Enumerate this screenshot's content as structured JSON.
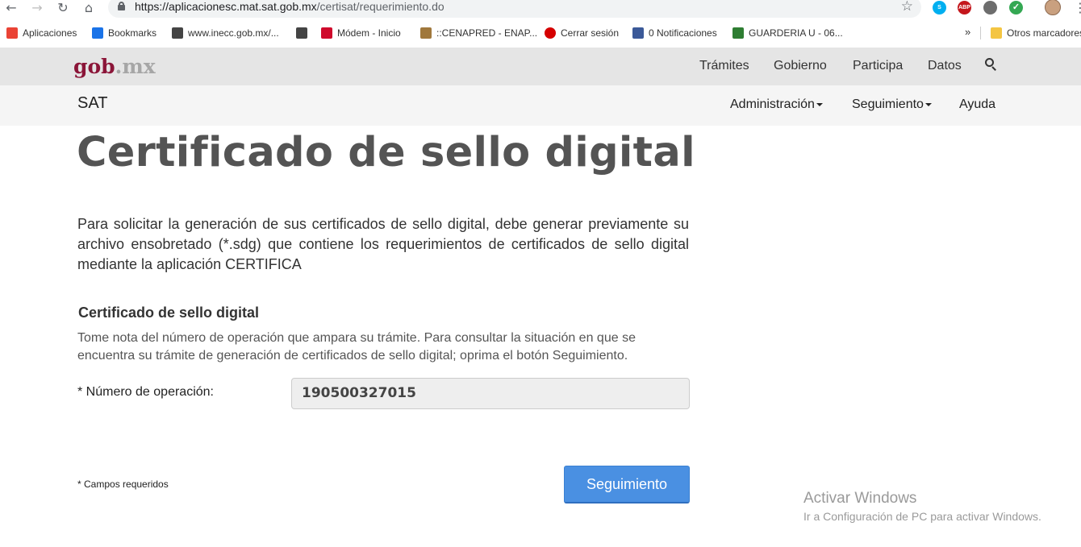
{
  "browser": {
    "url_host": "https://aplicacionesc.mat.sat.gob.mx",
    "url_path": "/certisat/requerimiento.do",
    "bookmarks": [
      {
        "label": "Aplicaciones",
        "icon": "apps-grid-icon",
        "color": "#ea4335"
      },
      {
        "label": "Bookmarks",
        "icon": "star-icon",
        "color": "#1a73e8"
      },
      {
        "label": "www.inecc.gob.mx/...",
        "icon": "globe-icon",
        "color": "#444444"
      },
      {
        "label": "",
        "icon": "globe-icon",
        "color": "#444444"
      },
      {
        "label": "Módem - Inicio",
        "icon": "huawei-icon",
        "color": "#cf0a2c"
      },
      {
        "label": "::CENAPRED - ENAP...",
        "icon": "cenapred-icon",
        "color": "#a0783c"
      },
      {
        "label": "Cerrar sesión",
        "icon": "red-circle-icon",
        "color": "#d50000"
      },
      {
        "label": "0 Notificaciones",
        "icon": "facebook-icon",
        "color": "#3b5998"
      },
      {
        "label": "GUARDERIA U - 06...",
        "icon": "guarderia-icon",
        "color": "#2e7d32"
      },
      {
        "label": "Otros marcadores",
        "icon": "folder-icon",
        "color": "#f4c542"
      }
    ],
    "overflow_label": "»",
    "extensions": [
      {
        "name": "skype-icon",
        "text": "S",
        "color": "#00aff0"
      },
      {
        "name": "adblock-icon",
        "text": "ABP",
        "color": "#c4161c"
      },
      {
        "name": "extension-gray-icon",
        "text": "",
        "color": "#6d6d6d"
      },
      {
        "name": "check-extension-icon",
        "text": "✓",
        "color": "#34a853"
      }
    ]
  },
  "gob_header": {
    "logo_main": "gob",
    "logo_dot": ".mx",
    "links": [
      "Trámites",
      "Gobierno",
      "Participa",
      "Datos"
    ]
  },
  "sat_header": {
    "title": "SAT",
    "menu": [
      "Administración",
      "Seguimiento",
      "Ayuda"
    ]
  },
  "main": {
    "title": "Certificado de sello digital",
    "intro": "Para solicitar la generación de sus certificados de sello digital, debe generar previamente su archivo ensobretado (*.sdg) que contiene los requerimientos de certificados de sello digital mediante la aplicación CERTIFICA",
    "section_title": "Certificado de sello digital",
    "section_desc": "Tome nota del número de operación que ampara su trámite. Para consultar la situación en que se encuentra su trámite de generación de certificados de sello digital; oprima el botón Seguimiento.",
    "field_label": "* Número de operación:",
    "field_value": "190500327015",
    "required_note": "* Campos requeridos",
    "button_label": "Seguimiento"
  },
  "watermark": {
    "line1": "Activar Windows",
    "line2": "Ir a Configuración de PC para activar Windows."
  }
}
